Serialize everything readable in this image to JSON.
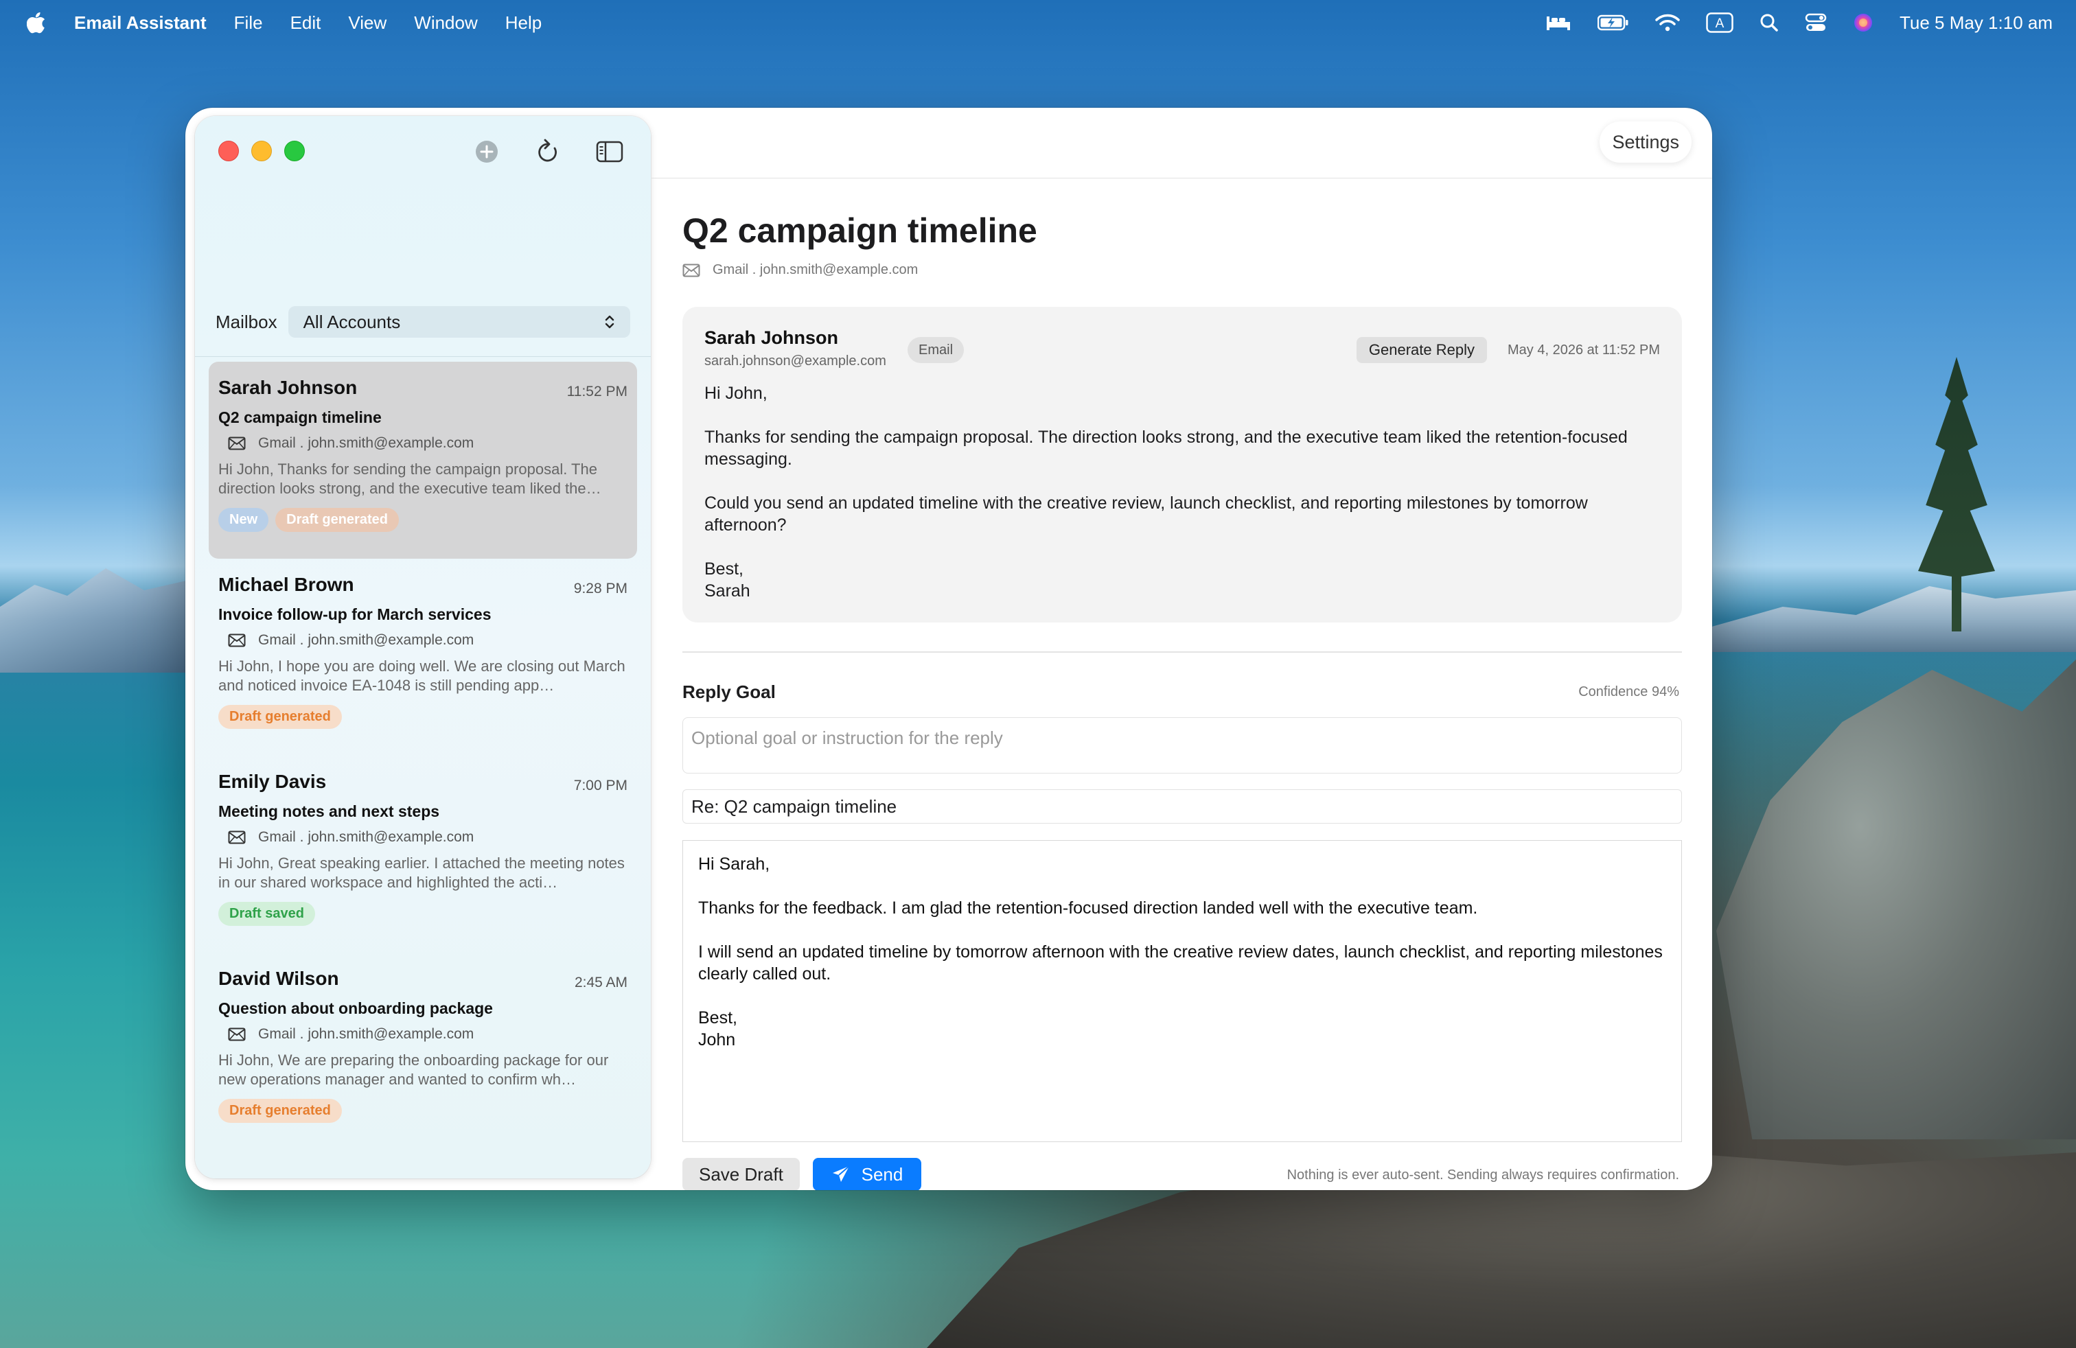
{
  "menubar": {
    "app_name": "Email Assistant",
    "menus": [
      "File",
      "Edit",
      "View",
      "Window",
      "Help"
    ],
    "clock": "Tue 5 May  1:10 am",
    "status_icons": [
      "bed-icon",
      "battery-charging-icon",
      "wifi-icon",
      "input-source-icon",
      "spotlight-icon",
      "control-center-icon",
      "siri-icon"
    ],
    "input_source_label": "A"
  },
  "sidebar": {
    "mailbox_label": "Mailbox",
    "mailbox_value": "All Accounts",
    "messages": [
      {
        "sender": "Sarah Johnson",
        "time": "11:52 PM",
        "subject": "Q2 campaign timeline",
        "account": "Gmail . john.smith@example.com",
        "preview": "Hi John,  Thanks for sending the campaign proposal. The direction looks strong, and the executive team liked the…",
        "badges": [
          "New",
          "Draft generated"
        ],
        "selected": true
      },
      {
        "sender": "Michael Brown",
        "time": "9:28 PM",
        "subject": "Invoice follow-up for March services",
        "account": "Gmail . john.smith@example.com",
        "preview": "Hi John,  I hope you are doing well. We are closing out March and noticed invoice EA-1048 is still pending app…",
        "badges": [
          "Draft generated"
        ]
      },
      {
        "sender": "Emily Davis",
        "time": "7:00 PM",
        "subject": "Meeting notes and next steps",
        "account": "Gmail . john.smith@example.com",
        "preview": "Hi John,  Great speaking earlier. I attached the meeting notes in our shared workspace and highlighted the acti…",
        "badges": [
          "Draft saved"
        ]
      },
      {
        "sender": "David Wilson",
        "time": "2:45 AM",
        "subject": "Question about onboarding package",
        "account": "Gmail . john.smith@example.com",
        "preview": "Hi John,  We are preparing the onboarding package for our new operations manager and wanted to confirm wh…",
        "badges": [
          "Draft generated"
        ]
      }
    ]
  },
  "main": {
    "settings_label": "Settings",
    "title": "Q2 campaign timeline",
    "account": "Gmail . john.smith@example.com",
    "email": {
      "sender": "Sarah Johnson",
      "address": "sarah.johnson@example.com",
      "chip": "Email",
      "generate_label": "Generate Reply",
      "date": "May 4, 2026 at 11:52 PM",
      "body": [
        "Hi John,",
        "Thanks for sending the campaign proposal. The direction looks strong, and the executive team liked the retention-focused messaging.",
        "Could you send an updated timeline with the creative review, launch checklist, and reporting milestones by tomorrow afternoon?",
        "Best,\nSarah"
      ]
    },
    "reply": {
      "goal_label": "Reply Goal",
      "confidence": "Confidence 94%",
      "goal_placeholder": "Optional goal or instruction for the reply",
      "subject": "Re: Q2 campaign timeline",
      "body": [
        "Hi Sarah,",
        "Thanks for the feedback. I am glad the retention-focused direction landed well with the executive team.",
        "I will send an updated timeline by tomorrow afternoon with the creative review dates, launch checklist, and reporting milestones clearly called out.",
        "Best,\nJohn"
      ],
      "save_label": "Save Draft",
      "send_label": "Send",
      "footnote": "Nothing is ever auto-sent. Sending always requires confirmation."
    }
  },
  "colors": {
    "accent": "#0a7cff",
    "badge_new": "#b8cfe8",
    "badge_draft_generated": "#e67e2e",
    "badge_draft_saved": "#2fa24a"
  }
}
